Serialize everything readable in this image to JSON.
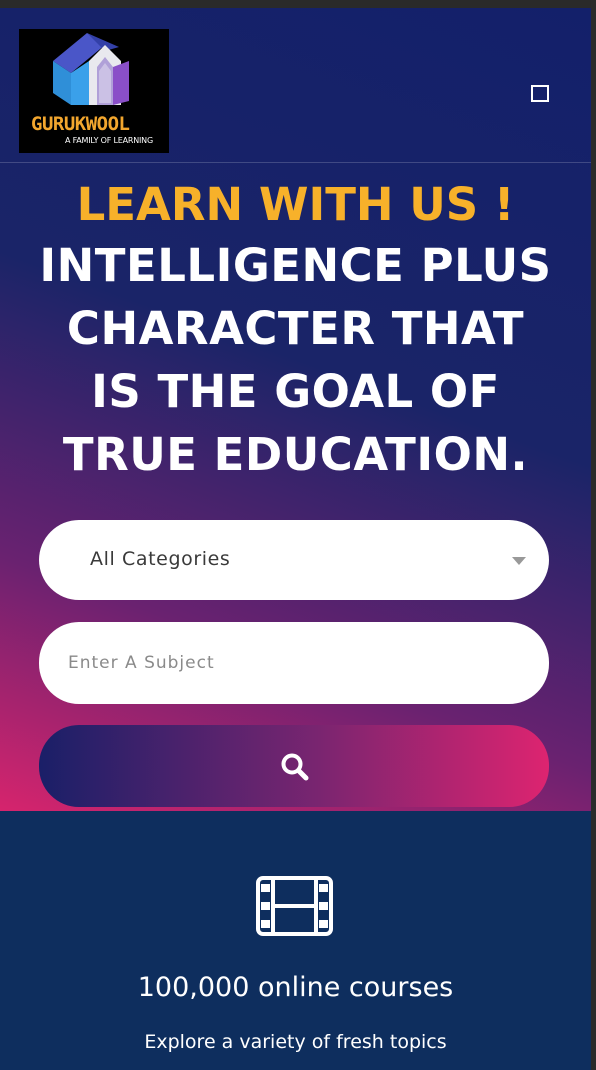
{
  "header": {
    "logo": {
      "name": "GURUKWOOL",
      "tagline": "A FAMILY OF LEARNING"
    },
    "menu_icon": "square-icon"
  },
  "hero": {
    "accent": "LEARN WITH US !",
    "lines": [
      "INTELLIGENCE PLUS",
      "CHARACTER THAT",
      "IS THE GOAL OF",
      "TRUE EDUCATION."
    ],
    "category_select": {
      "value": "All Categories"
    },
    "subject_input": {
      "placeholder": "Enter A Subject",
      "value": ""
    },
    "search_icon": "search-icon"
  },
  "features": {
    "icon": "film-icon",
    "title": "100,000 online courses",
    "description": "Explore a variety of fresh topics"
  },
  "colors": {
    "accent": "#f7b12a",
    "hero_top": "#13206a",
    "hero_bottom": "#d6246d",
    "section_bg": "#0e2e5e"
  }
}
